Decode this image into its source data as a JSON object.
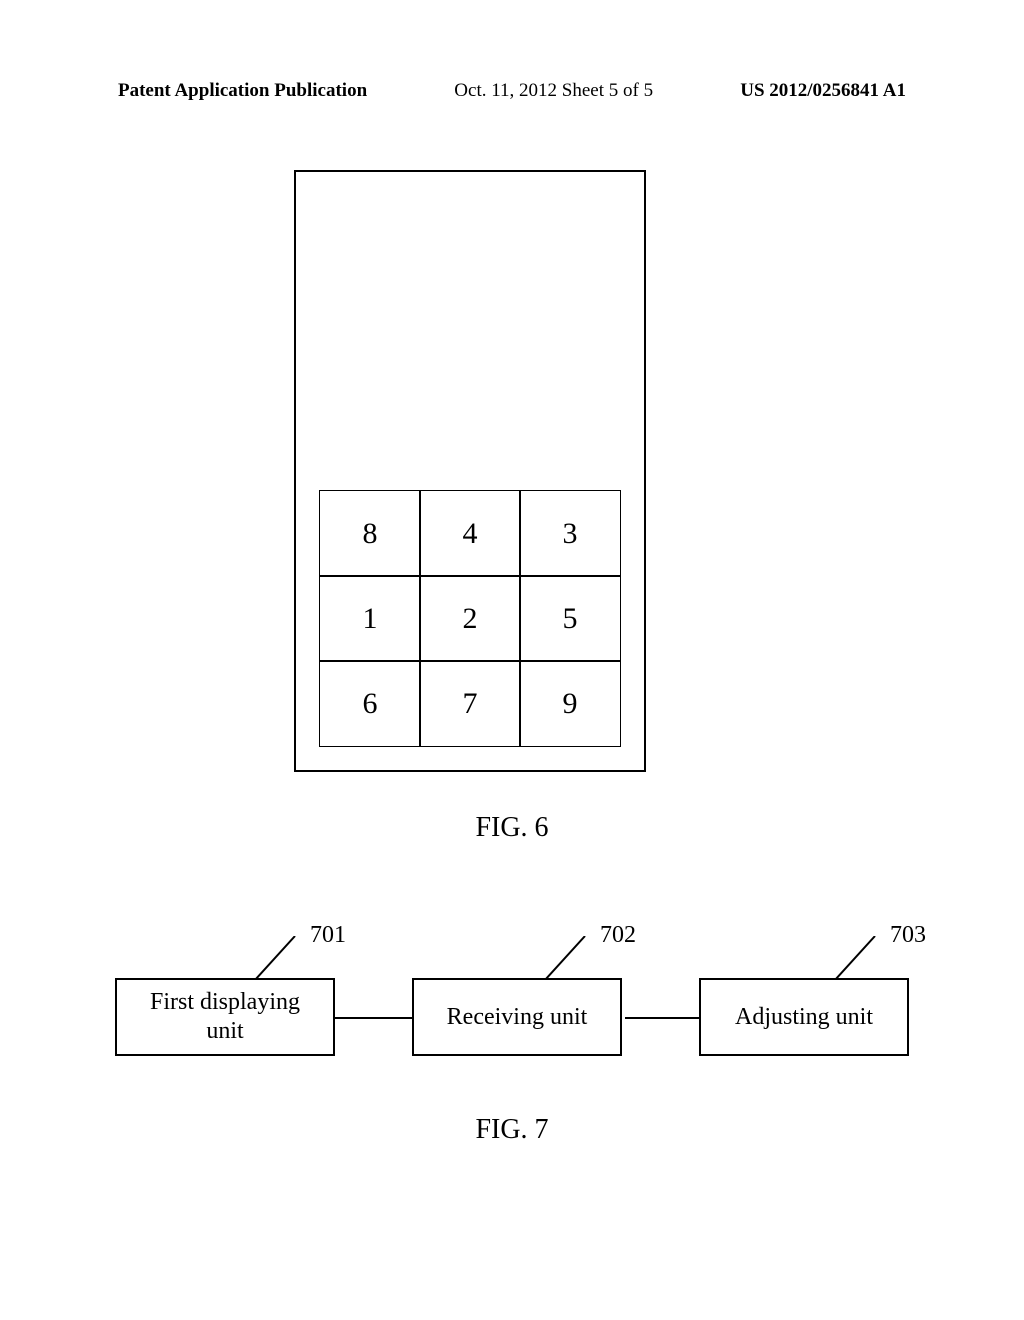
{
  "header": {
    "left": "Patent Application Publication",
    "center": "Oct. 11, 2012  Sheet 5 of 5",
    "right": "US 2012/0256841 A1"
  },
  "grid": {
    "cells": [
      "8",
      "4",
      "3",
      "1",
      "2",
      "5",
      "6",
      "7",
      "9"
    ]
  },
  "fig6": "FIG. 6",
  "fig7": "FIG. 7",
  "blocks": {
    "b1": {
      "label": "First displaying\nunit",
      "ref": "701"
    },
    "b2": {
      "label": "Receiving unit",
      "ref": "702"
    },
    "b3": {
      "label": "Adjusting unit",
      "ref": "703"
    }
  }
}
